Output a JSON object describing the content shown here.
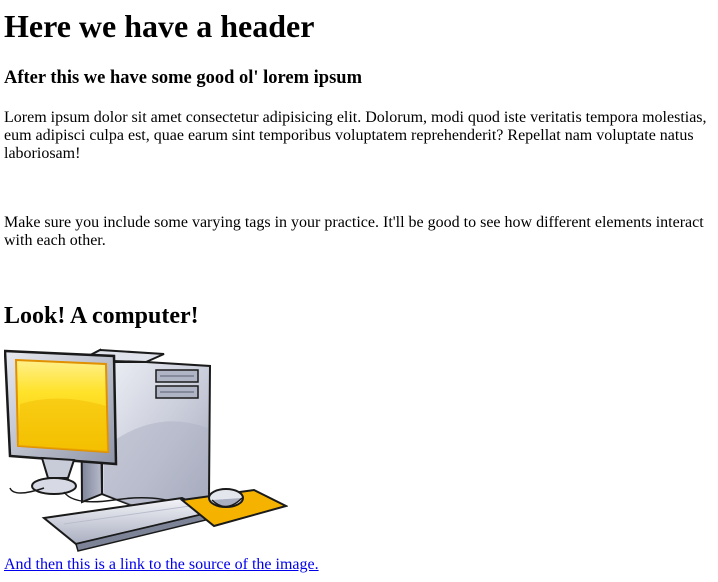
{
  "header": {
    "title": "Here we have a header",
    "subtitle": "After this we have some good ol' lorem ipsum"
  },
  "paragraphs": [
    "Lorem ipsum dolor sit amet consectetur adipisicing elit. Dolorum, modi quod iste veritatis tempora molestias, eum adipisci culpa est, quae earum sint temporibus voluptatem reprehenderit? Repellat nam voluptate natus laboriosam!",
    "Make sure you include some varying tags in your practice. It'll be good to see how different elements interact with each other."
  ],
  "section": {
    "title": "Look! A computer!"
  },
  "image": {
    "icon": "desktop-computer-clipart"
  },
  "link": {
    "label": "And then this is a link to the source of the image."
  },
  "colors": {
    "link": "#0000ee",
    "screen": "#ffd400",
    "mousepad": "#f5b300"
  }
}
